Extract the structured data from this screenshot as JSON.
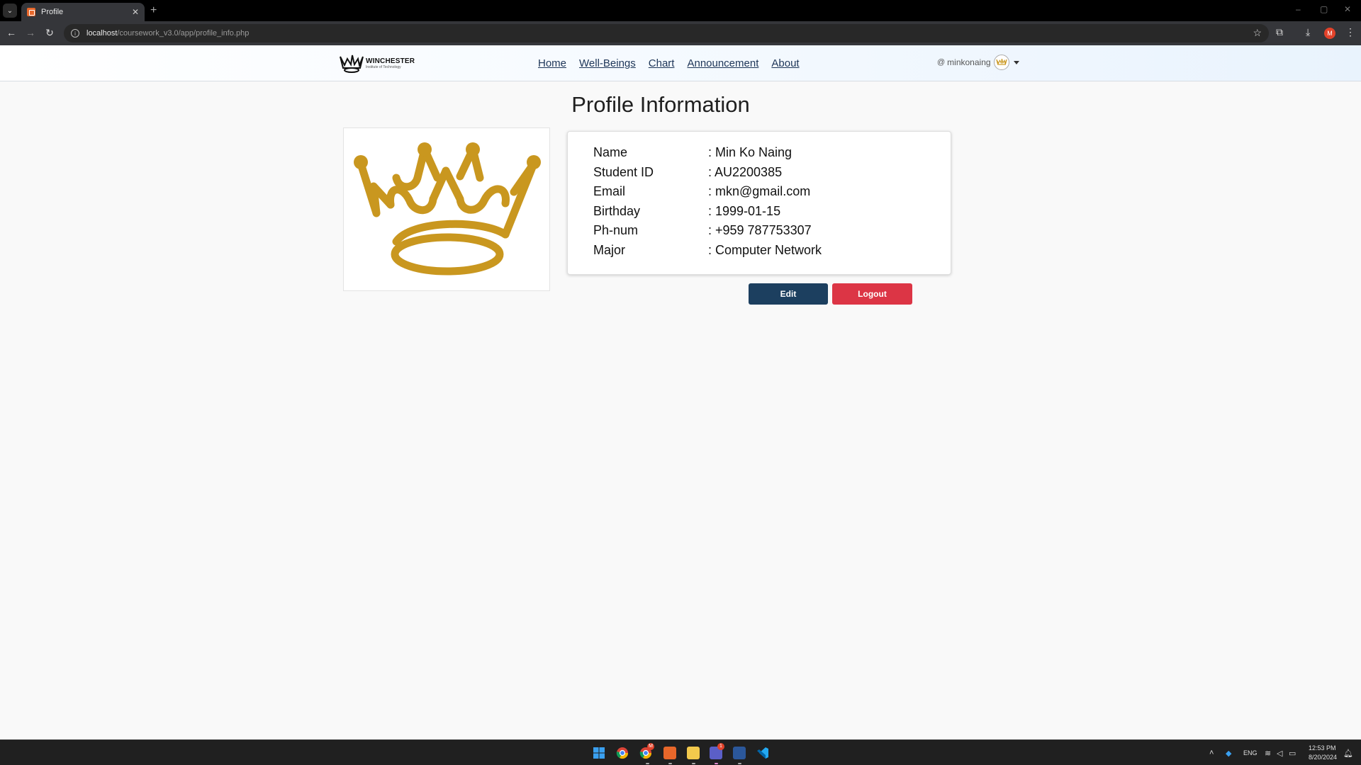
{
  "browser": {
    "tab_title": "Profile",
    "new_tab": "+",
    "close": "✕",
    "url_host": "localhost",
    "url_path": "/coursework_v3.0/app/profile_info.php",
    "profile_initial": "M",
    "window_controls": [
      "–",
      "▢",
      "✕"
    ]
  },
  "site": {
    "logo_title": "WINCHESTER",
    "logo_subtitle": "Institute of Technology",
    "nav": [
      "Home",
      "Well-Beings",
      "Chart",
      "Announcement",
      "About"
    ],
    "user": {
      "at": "@",
      "username": "minkonaing"
    }
  },
  "profile": {
    "title": "Profile Information",
    "fields": [
      {
        "label": "Name",
        "value": ": Min Ko Naing"
      },
      {
        "label": "Student ID",
        "value": ": AU2200385"
      },
      {
        "label": "Email",
        "value": ": mkn@gmail.com"
      },
      {
        "label": "Birthday",
        "value": ": 1999-01-15"
      },
      {
        "label": "Ph-num",
        "value": ": +959 787753307"
      },
      {
        "label": "Major",
        "value": ": Computer Network"
      }
    ],
    "edit_label": "Edit",
    "logout_label": "Logout"
  },
  "colors": {
    "crown_gold": "#c9971f",
    "edit_button": "#1c3f5f",
    "logout_button": "#dc3545",
    "nav_link": "#1d3557"
  },
  "taskbar": {
    "tray_lang": "ENG",
    "time": "12:53 PM",
    "date": "8/20/2024",
    "badges": [
      "M",
      "1"
    ]
  }
}
